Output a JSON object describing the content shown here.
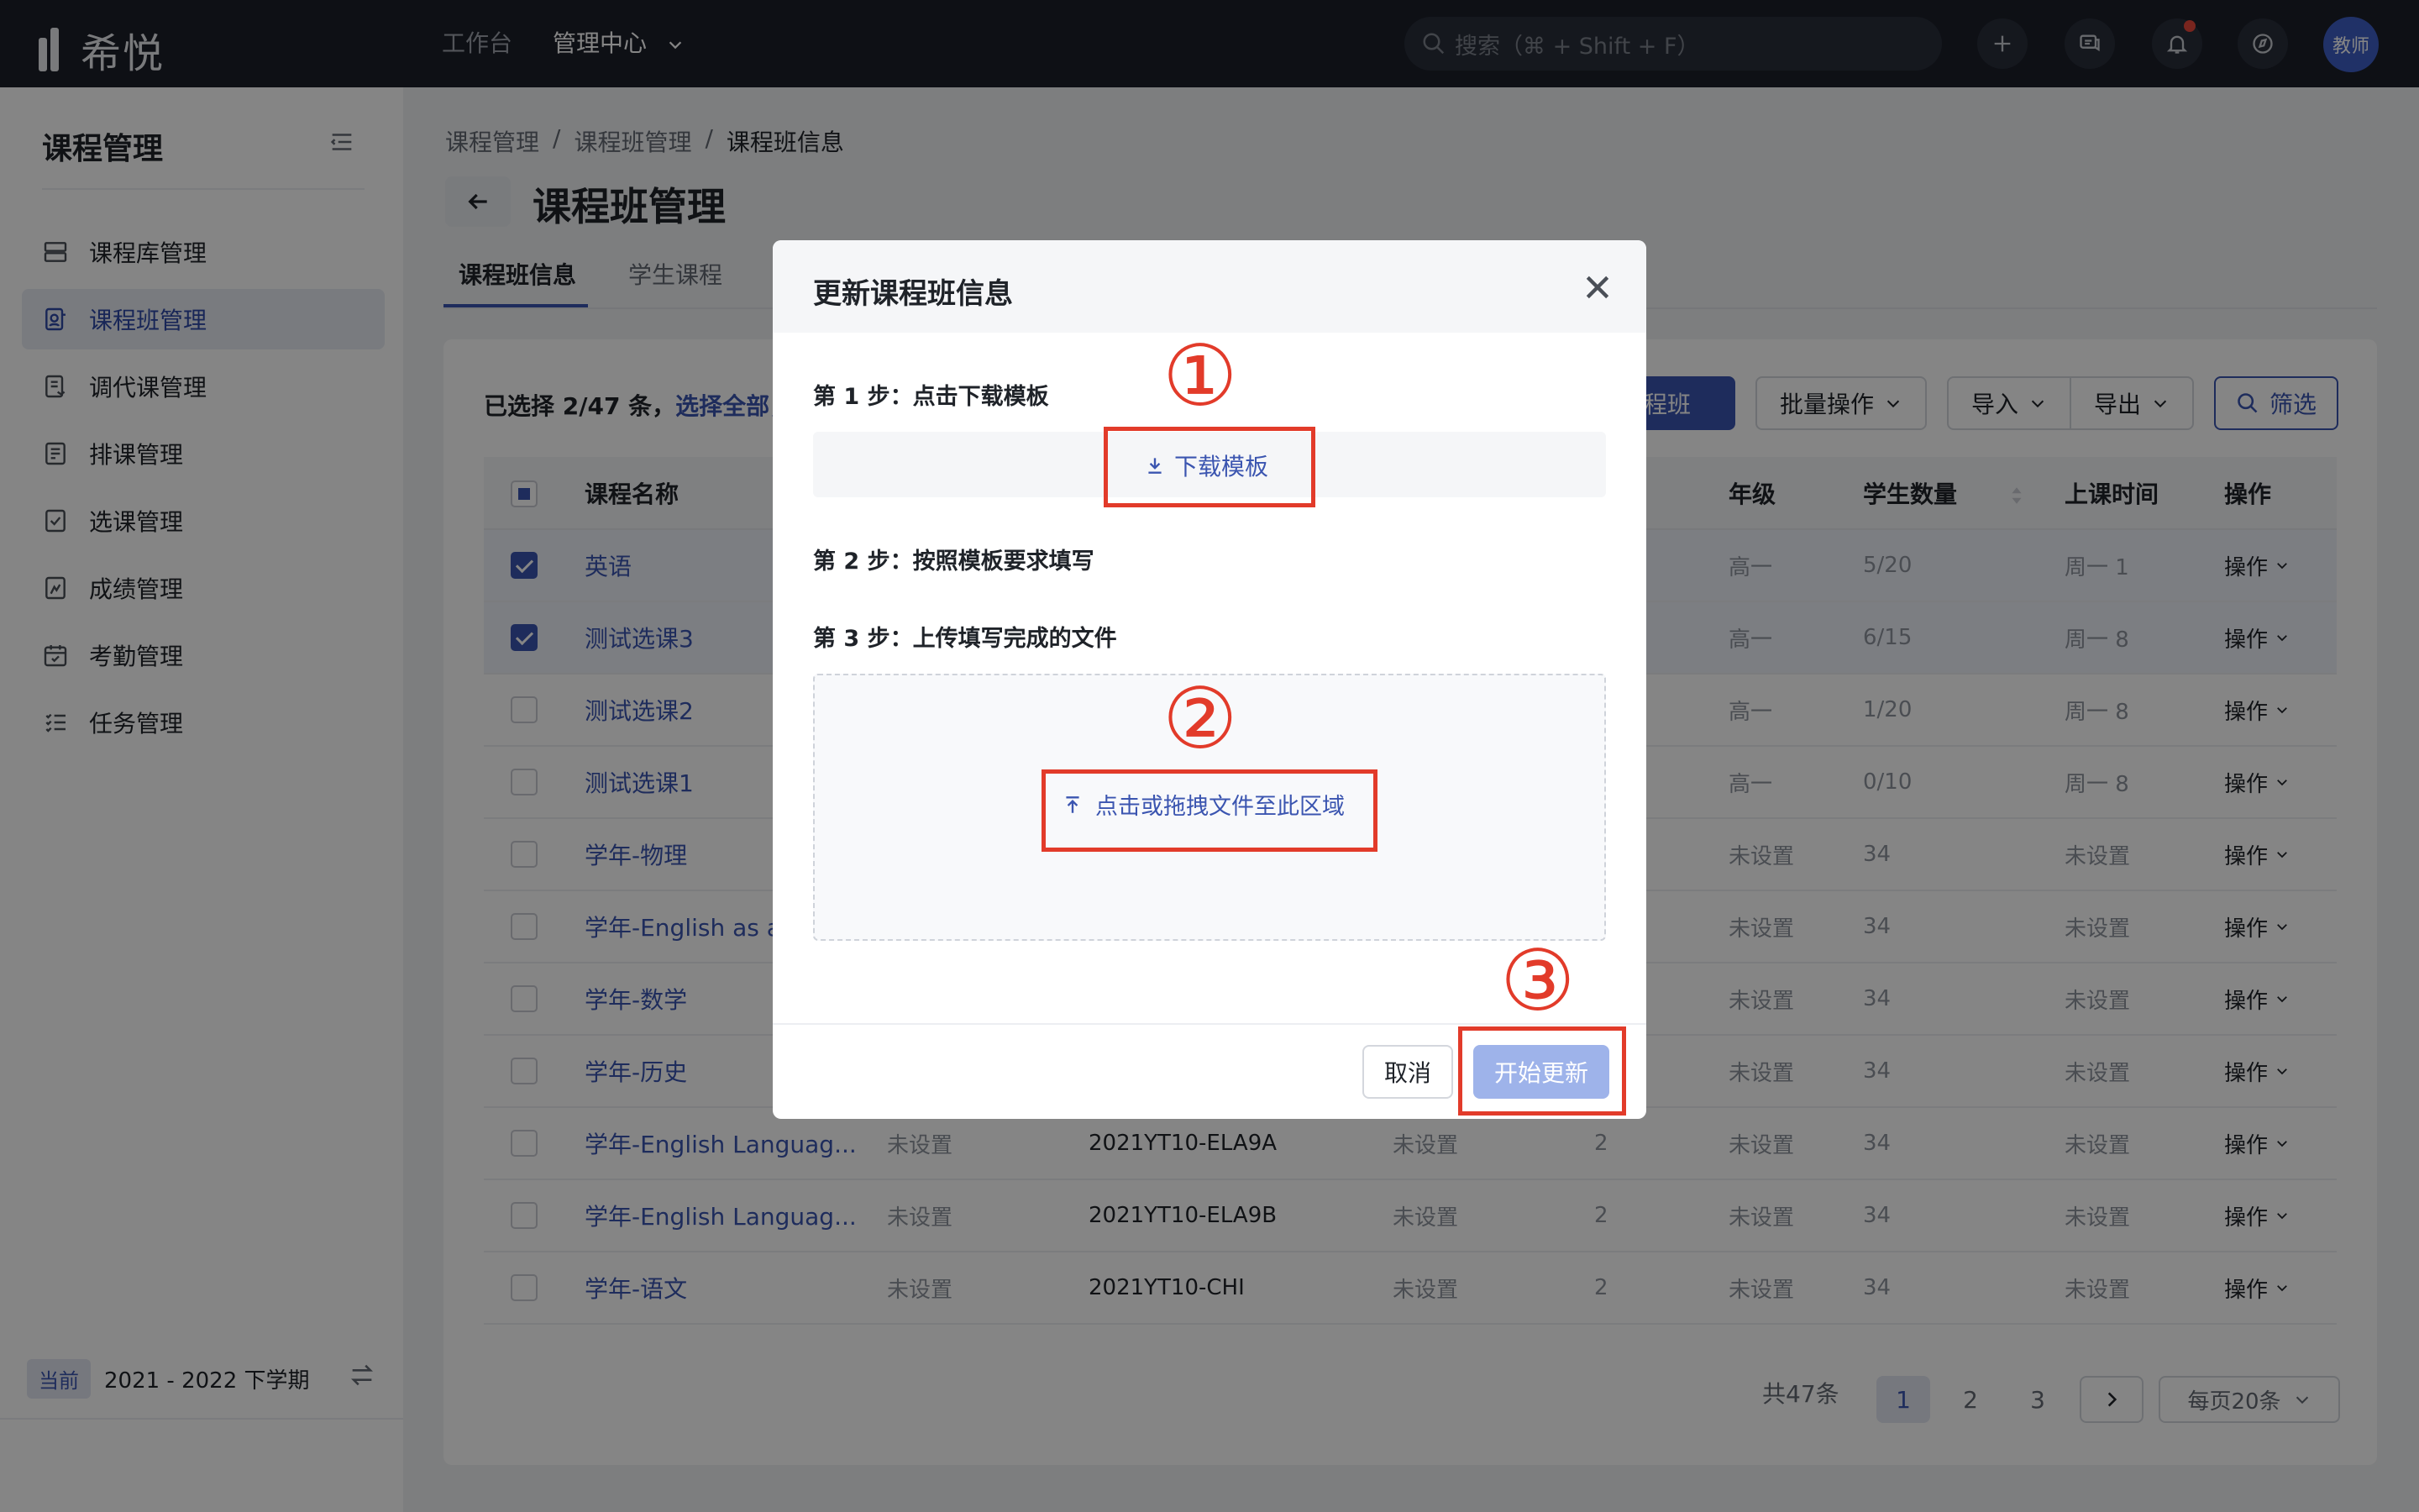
{
  "brand": {
    "name": "希悦"
  },
  "topnav": {
    "items": [
      {
        "label": "工作台"
      },
      {
        "label": "管理中心"
      }
    ],
    "search_placeholder": "搜索（⌘ + Shift + F）",
    "avatar_label": "教师"
  },
  "sidebar": {
    "title": "课程管理",
    "items": [
      {
        "label": "课程库管理",
        "icon": "database-icon"
      },
      {
        "label": "课程班管理",
        "icon": "class-icon",
        "active": true
      },
      {
        "label": "调代课管理",
        "icon": "swap-course-icon"
      },
      {
        "label": "排课管理",
        "icon": "schedule-icon"
      },
      {
        "label": "选课管理",
        "icon": "select-course-icon"
      },
      {
        "label": "成绩管理",
        "icon": "grade-icon"
      },
      {
        "label": "考勤管理",
        "icon": "calendar-icon"
      },
      {
        "label": "任务管理",
        "icon": "task-list-icon"
      }
    ],
    "term_badge": "当前",
    "term_label": "2021 - 2022 下学期"
  },
  "breadcrumb": [
    "课程管理",
    "课程班管理",
    "课程班信息"
  ],
  "page_title": "课程班管理",
  "tabs": [
    {
      "label": "课程班信息",
      "active": true
    },
    {
      "label": "学生课程"
    }
  ],
  "selection": {
    "text": "已选择 2/47 条，",
    "select_all": "选择全部，"
  },
  "toolbar": {
    "add_label": "课程班",
    "batch_label": "批量操作",
    "import_label": "导入",
    "export_label": "导出",
    "filter_label": "筛选"
  },
  "table": {
    "headers": [
      "课程名称",
      "",
      "",
      "",
      "",
      "年级",
      "学生数量",
      "上课时间",
      "操作"
    ],
    "rows": [
      {
        "checked": true,
        "name": "英语",
        "c2": "",
        "c3": "",
        "c4": "",
        "c5": "置",
        "grade": "高一",
        "count": "5/20",
        "time": "周一 1",
        "op": "操作"
      },
      {
        "checked": true,
        "name": "测试选课3",
        "c2": "",
        "c3": "",
        "c4": "",
        "c5": "置",
        "grade": "高一",
        "count": "6/15",
        "time": "周一 8",
        "op": "操作"
      },
      {
        "checked": false,
        "name": "测试选课2",
        "c2": "",
        "c3": "",
        "c4": "",
        "c5": "置",
        "grade": "高一",
        "count": "1/20",
        "time": "周一 8",
        "op": "操作"
      },
      {
        "checked": false,
        "name": "测试选课1",
        "c2": "",
        "c3": "",
        "c4": "",
        "c5": "置",
        "grade": "高一",
        "count": "0/10",
        "time": "周一 8",
        "op": "操作"
      },
      {
        "checked": false,
        "name": "学年-物理",
        "c2": "",
        "c3": "",
        "c4": "",
        "c5": "",
        "grade": "未设置",
        "count": "34",
        "time": "未设置",
        "op": "操作"
      },
      {
        "checked": false,
        "name": "学年-English as a",
        "c2": "",
        "c3": "",
        "c4": "",
        "c5": "",
        "grade": "未设置",
        "count": "34",
        "time": "未设置",
        "op": "操作"
      },
      {
        "checked": false,
        "name": "学年-数学",
        "c2": "",
        "c3": "",
        "c4": "",
        "c5": "",
        "grade": "未设置",
        "count": "34",
        "time": "未设置",
        "op": "操作"
      },
      {
        "checked": false,
        "name": "学年-历史",
        "c2": "",
        "c3": "",
        "c4": "",
        "c5": "",
        "grade": "未设置",
        "count": "34",
        "time": "未设置",
        "op": "操作"
      },
      {
        "checked": false,
        "name": "学年-English Languag...",
        "c2": "未设置",
        "c3": "2021YT10-ELA9A",
        "c4": "未设置",
        "c5": "2",
        "grade": "未设置",
        "count": "34",
        "time": "未设置",
        "op": "操作"
      },
      {
        "checked": false,
        "name": "学年-English Languag...",
        "c2": "未设置",
        "c3": "2021YT10-ELA9B",
        "c4": "未设置",
        "c5": "2",
        "grade": "未设置",
        "count": "34",
        "time": "未设置",
        "op": "操作"
      },
      {
        "checked": false,
        "name": "学年-语文",
        "c2": "未设置",
        "c3": "2021YT10-CHI",
        "c4": "未设置",
        "c5": "2",
        "grade": "未设置",
        "count": "34",
        "time": "未设置",
        "op": "操作"
      }
    ]
  },
  "pagination": {
    "total": "共47条",
    "pages": [
      "1",
      "2",
      "3"
    ],
    "current": "1",
    "per_page": "每页20条"
  },
  "modal": {
    "title": "更新课程班信息",
    "step1": "第 1 步：点击下载模板",
    "download_label": "下载模板",
    "step2": "第 2 步：按照模板要求填写",
    "step3": "第 3 步：上传填写完成的文件",
    "upload_label": "点击或拖拽文件至此区域",
    "cancel_label": "取消",
    "start_label": "开始更新"
  },
  "annotations": [
    "①",
    "②",
    "③"
  ],
  "colors": {
    "accent": "#3b55b0",
    "annotation": "#e23b2a",
    "topbar": "#1b1f2a"
  }
}
